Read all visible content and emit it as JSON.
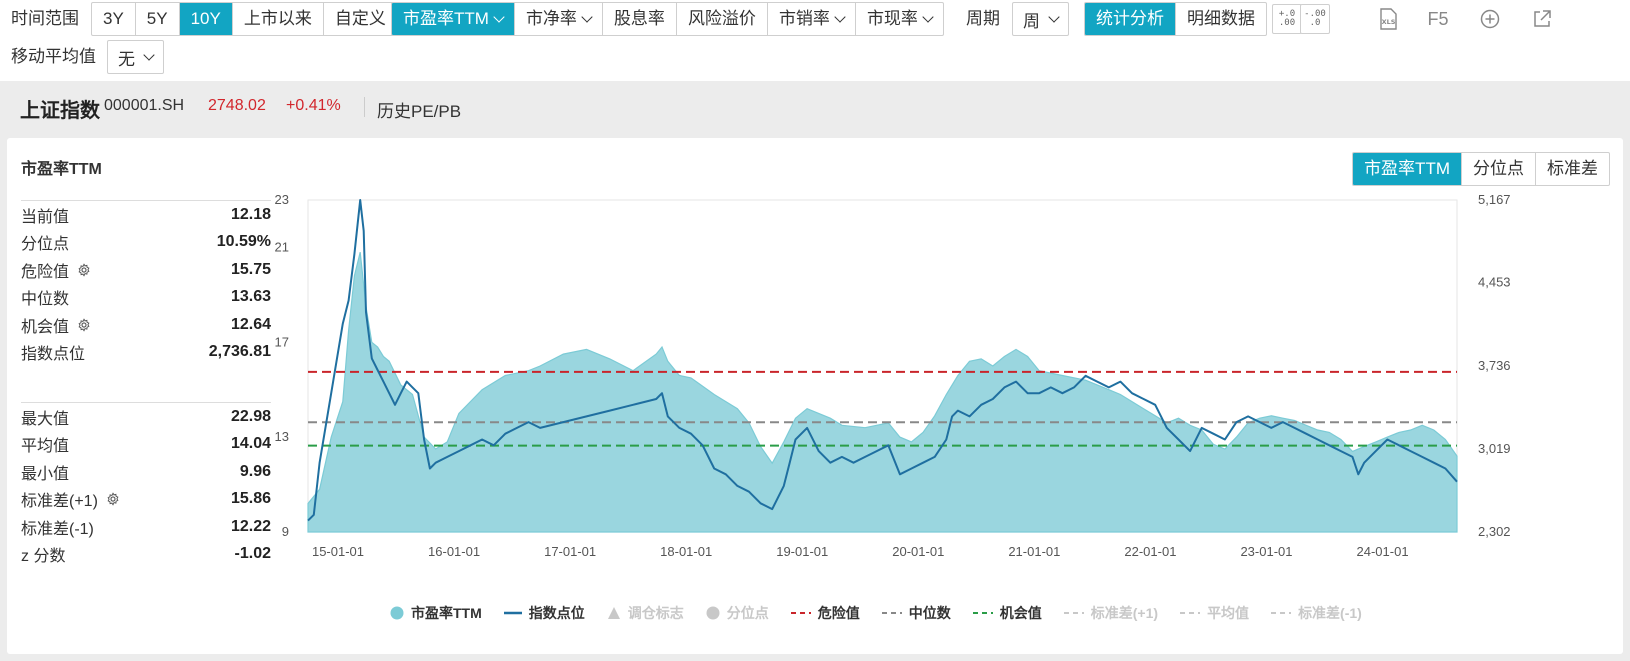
{
  "toolbar": {
    "time_range_label": "时间范围",
    "time_buttons": [
      "3Y",
      "5Y",
      "10Y",
      "上市以来",
      "自定义"
    ],
    "metric_buttons": [
      "市盈率TTM",
      "市净率",
      "股息率",
      "风险溢价",
      "市销率",
      "市现率"
    ],
    "period_label": "周期",
    "period_value": "周",
    "view_buttons": [
      "统计分析",
      "明细数据"
    ],
    "decimal_inc": "+.0\n.00",
    "decimal_dec": "-.00\n.0",
    "xls_label": "XLS",
    "f5_label": "F5",
    "ma_label": "移动平均值",
    "ma_value": "无"
  },
  "header": {
    "name": "上证指数",
    "code": "000001.SH",
    "price": "2748.02",
    "change": "+0.41%",
    "history": "历史PE/PB"
  },
  "panel": {
    "title": "市盈率TTM",
    "right_tabs": [
      "市盈率TTM",
      "分位点",
      "标准差"
    ],
    "stats_top": [
      {
        "label": "当前值",
        "value": "12.18",
        "gear": false
      },
      {
        "label": "分位点",
        "value": "10.59%",
        "gear": false
      },
      {
        "label": "危险值",
        "value": "15.75",
        "gear": true
      },
      {
        "label": "中位数",
        "value": "13.63",
        "gear": false
      },
      {
        "label": "机会值",
        "value": "12.64",
        "gear": true
      },
      {
        "label": "指数点位",
        "value": "2,736.81",
        "gear": false
      }
    ],
    "stats_bottom": [
      {
        "label": "最大值",
        "value": "22.98",
        "gear": false
      },
      {
        "label": "平均值",
        "value": "14.04",
        "gear": false
      },
      {
        "label": "最小值",
        "value": "9.96",
        "gear": false
      },
      {
        "label": "标准差(+1)",
        "value": "15.86",
        "gear": true
      },
      {
        "label": "标准差(-1)",
        "value": "12.22",
        "gear": false
      },
      {
        "label": "z 分数",
        "value": "-1.02",
        "gear": false
      }
    ]
  },
  "colors": {
    "accent": "#12a5c3",
    "area": "#9ad6df",
    "area_line": "#7ccbd6",
    "index_line": "#1f6fa0",
    "danger": "#c9252b",
    "median": "#888888",
    "opportunity": "#2a9d48",
    "up": "#d2262c"
  },
  "chart_data": {
    "type": "area",
    "x_ticks": [
      "15-01-01",
      "16-01-01",
      "17-01-01",
      "18-01-01",
      "19-01-01",
      "20-01-01",
      "21-01-01",
      "22-01-01",
      "23-01-01",
      "24-01-01"
    ],
    "x_range": [
      2015.0,
      2024.9
    ],
    "y_left_ticks": [
      "9",
      "13",
      "17",
      "21",
      "23"
    ],
    "y_left_range": [
      9,
      23
    ],
    "y_right_ticks": [
      "2,302",
      "3,019",
      "3,736",
      "4,453",
      "5,167"
    ],
    "y_right_range": [
      2302,
      5167
    ],
    "grid": false,
    "legend_position": "bottom",
    "series": [
      {
        "name": "市盈率TTM",
        "type": "area",
        "axis": "left",
        "x": [
          2015.0,
          2015.1,
          2015.2,
          2015.3,
          2015.35,
          2015.4,
          2015.45,
          2015.5,
          2015.55,
          2015.6,
          2015.65,
          2015.7,
          2015.8,
          2015.9,
          2016.0,
          2016.1,
          2016.2,
          2016.3,
          2016.5,
          2016.7,
          2016.9,
          2017.0,
          2017.2,
          2017.4,
          2017.6,
          2017.8,
          2018.0,
          2018.05,
          2018.1,
          2018.2,
          2018.3,
          2018.5,
          2018.7,
          2018.8,
          2018.9,
          2019.0,
          2019.1,
          2019.2,
          2019.3,
          2019.4,
          2019.5,
          2019.6,
          2019.8,
          2020.0,
          2020.1,
          2020.2,
          2020.3,
          2020.4,
          2020.5,
          2020.6,
          2020.7,
          2020.8,
          2020.9,
          2021.0,
          2021.1,
          2021.2,
          2021.3,
          2021.5,
          2021.7,
          2021.9,
          2022.0,
          2022.1,
          2022.2,
          2022.3,
          2022.4,
          2022.5,
          2022.6,
          2022.7,
          2022.8,
          2022.9,
          2023.0,
          2023.1,
          2023.2,
          2023.3,
          2023.4,
          2023.5,
          2023.6,
          2023.7,
          2023.8,
          2023.9,
          2024.0,
          2024.1,
          2024.2,
          2024.3,
          2024.4,
          2024.5,
          2024.6,
          2024.7,
          2024.8,
          2024.9
        ],
        "values": [
          10.2,
          10.8,
          13.0,
          14.5,
          17.5,
          19.8,
          20.8,
          18.5,
          17.0,
          16.8,
          16.4,
          16.2,
          15.2,
          14.8,
          13.0,
          12.5,
          12.8,
          14.0,
          15.0,
          15.6,
          15.8,
          16.0,
          16.5,
          16.7,
          16.3,
          15.8,
          16.5,
          16.8,
          16.2,
          15.6,
          15.5,
          14.8,
          14.2,
          13.6,
          12.6,
          11.9,
          12.8,
          13.8,
          14.2,
          14.0,
          13.8,
          13.5,
          13.4,
          13.6,
          13.0,
          12.8,
          13.2,
          13.9,
          14.8,
          15.6,
          16.2,
          16.3,
          16.0,
          16.4,
          16.7,
          16.4,
          15.8,
          15.6,
          15.4,
          15.0,
          14.8,
          14.5,
          14.2,
          13.9,
          13.6,
          13.8,
          13.5,
          13.3,
          12.7,
          12.5,
          13.0,
          13.6,
          13.8,
          13.9,
          13.8,
          13.7,
          13.5,
          13.3,
          13.2,
          12.9,
          12.4,
          12.6,
          12.8,
          13.0,
          13.2,
          13.3,
          13.5,
          13.3,
          12.9,
          12.2
        ]
      },
      {
        "name": "指数点位",
        "type": "line",
        "axis": "right",
        "x": [
          2015.0,
          2015.05,
          2015.1,
          2015.2,
          2015.3,
          2015.35,
          2015.4,
          2015.45,
          2015.48,
          2015.5,
          2015.55,
          2015.6,
          2015.65,
          2015.7,
          2015.75,
          2015.8,
          2015.85,
          2015.9,
          2015.95,
          2016.0,
          2016.05,
          2016.1,
          2016.2,
          2016.3,
          2016.4,
          2016.5,
          2016.6,
          2016.7,
          2016.8,
          2016.9,
          2017.0,
          2017.2,
          2017.4,
          2017.6,
          2017.8,
          2018.0,
          2018.05,
          2018.1,
          2018.2,
          2018.3,
          2018.4,
          2018.5,
          2018.6,
          2018.7,
          2018.8,
          2018.9,
          2019.0,
          2019.1,
          2019.15,
          2019.2,
          2019.3,
          2019.4,
          2019.5,
          2019.6,
          2019.7,
          2019.8,
          2019.9,
          2020.0,
          2020.1,
          2020.2,
          2020.3,
          2020.4,
          2020.5,
          2020.55,
          2020.6,
          2020.7,
          2020.8,
          2020.9,
          2021.0,
          2021.1,
          2021.2,
          2021.3,
          2021.4,
          2021.5,
          2021.6,
          2021.7,
          2021.8,
          2021.9,
          2022.0,
          2022.1,
          2022.2,
          2022.3,
          2022.4,
          2022.5,
          2022.6,
          2022.7,
          2022.8,
          2022.9,
          2023.0,
          2023.1,
          2023.2,
          2023.3,
          2023.4,
          2023.5,
          2023.6,
          2023.7,
          2023.8,
          2023.9,
          2024.0,
          2024.05,
          2024.1,
          2024.2,
          2024.3,
          2024.4,
          2024.5,
          2024.6,
          2024.7,
          2024.8,
          2024.9
        ],
        "values": [
          2400,
          2450,
          2900,
          3500,
          4100,
          4300,
          4700,
          5167,
          4900,
          4200,
          3800,
          3700,
          3600,
          3500,
          3400,
          3500,
          3600,
          3550,
          3500,
          3100,
          2850,
          2900,
          2950,
          3000,
          3050,
          3100,
          3050,
          3150,
          3200,
          3250,
          3200,
          3250,
          3300,
          3350,
          3400,
          3450,
          3500,
          3300,
          3200,
          3150,
          3050,
          2850,
          2800,
          2700,
          2650,
          2550,
          2500,
          2700,
          2900,
          3100,
          3200,
          3000,
          2900,
          2950,
          2900,
          2950,
          3000,
          3050,
          2800,
          2850,
          2900,
          2950,
          3100,
          3300,
          3350,
          3300,
          3400,
          3450,
          3550,
          3600,
          3500,
          3500,
          3550,
          3500,
          3550,
          3650,
          3600,
          3550,
          3600,
          3500,
          3450,
          3400,
          3200,
          3100,
          3000,
          3200,
          3150,
          3100,
          3250,
          3300,
          3250,
          3200,
          3250,
          3200,
          3150,
          3100,
          3050,
          3000,
          2950,
          2800,
          2900,
          3000,
          3100,
          3050,
          3000,
          2950,
          2900,
          2850,
          2736
        ]
      }
    ],
    "reference_lines": [
      {
        "name": "危险值",
        "value": 15.75,
        "style": "dashed"
      },
      {
        "name": "中位数",
        "value": 13.63,
        "style": "dashed"
      },
      {
        "name": "机会值",
        "value": 12.64,
        "style": "dashed"
      }
    ],
    "legend": [
      {
        "name": "市盈率TTM",
        "marker": "circle",
        "enabled": true
      },
      {
        "name": "指数点位",
        "marker": "line",
        "enabled": true
      },
      {
        "name": "调仓标志",
        "marker": "triangle",
        "enabled": false
      },
      {
        "name": "分位点",
        "marker": "circle",
        "enabled": false
      },
      {
        "name": "危险值",
        "marker": "dash",
        "enabled": true
      },
      {
        "name": "中位数",
        "marker": "dash",
        "enabled": true
      },
      {
        "name": "机会值",
        "marker": "dash",
        "enabled": true
      },
      {
        "name": "标准差(+1)",
        "marker": "dash",
        "enabled": false
      },
      {
        "name": "平均值",
        "marker": "dash",
        "enabled": false
      },
      {
        "name": "标准差(-1)",
        "marker": "dash",
        "enabled": false
      }
    ]
  }
}
